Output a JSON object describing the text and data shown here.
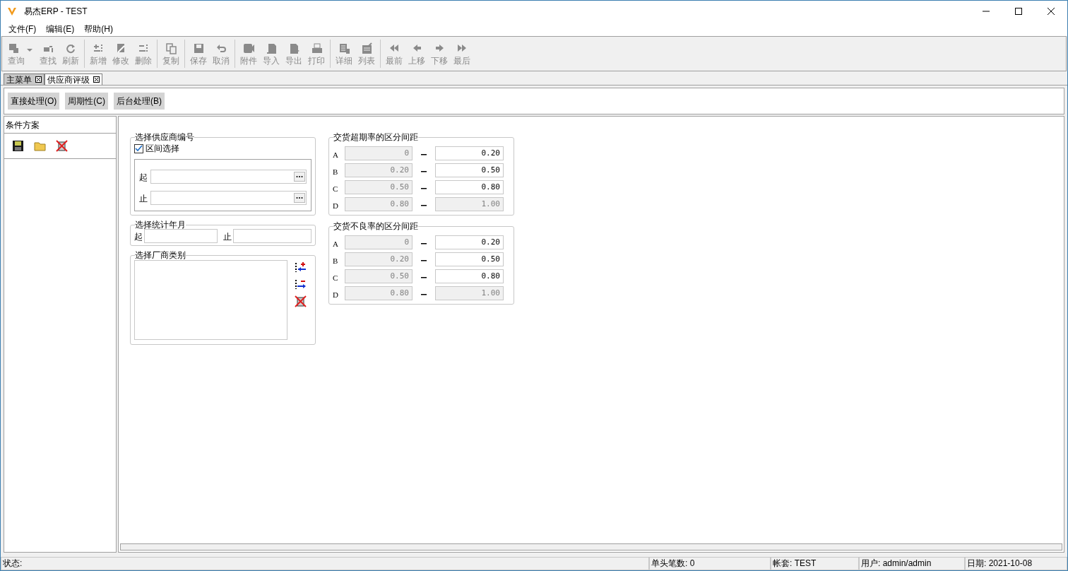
{
  "window": {
    "title": "易杰ERP - TEST"
  },
  "menu": [
    "文件(F)",
    "编辑(E)",
    "帮助(H)"
  ],
  "toolbar": [
    [
      {
        "label": "查询",
        "dropdown": true,
        "disabled": true
      },
      {
        "label": "查找",
        "disabled": true
      },
      {
        "label": "刷新",
        "disabled": true
      }
    ],
    [
      {
        "label": "新增",
        "disabled": true
      },
      {
        "label": "修改",
        "disabled": true
      },
      {
        "label": "删除",
        "disabled": true
      }
    ],
    [
      {
        "label": "复制",
        "disabled": true
      }
    ],
    [
      {
        "label": "保存",
        "disabled": true
      },
      {
        "label": "取消",
        "disabled": true
      }
    ],
    [
      {
        "label": "附件",
        "disabled": true
      },
      {
        "label": "导入",
        "disabled": true
      },
      {
        "label": "导出",
        "disabled": true
      },
      {
        "label": "打印",
        "disabled": true
      }
    ],
    [
      {
        "label": "详细",
        "disabled": true
      },
      {
        "label": "列表",
        "disabled": true
      }
    ],
    [
      {
        "label": "最前",
        "disabled": true
      },
      {
        "label": "上移",
        "disabled": true
      },
      {
        "label": "下移",
        "disabled": true
      },
      {
        "label": "最后",
        "disabled": true
      }
    ]
  ],
  "tabs": [
    {
      "label": "主菜单",
      "selected": false
    },
    {
      "label": "供应商评级",
      "selected": true
    }
  ],
  "actions": [
    "直接处理(O)",
    "周期性(C)",
    "后台处理(B)"
  ],
  "sidebar": {
    "title": "条件方案"
  },
  "supplier": {
    "legend": "选择供应商编号",
    "range_checkbox": {
      "label": "区间选择",
      "checked": true
    },
    "from_label": "起",
    "to_label": "止"
  },
  "period": {
    "legend": "选择统计年月",
    "from_label": "起",
    "to_label": "止"
  },
  "category": {
    "legend": "选择厂商类别"
  },
  "ranges": [
    {
      "legend": "交货超期率的区分间距",
      "rows": [
        {
          "grade": "A",
          "from": "0",
          "to": "0.20",
          "to_disabled": false
        },
        {
          "grade": "B",
          "from": "0.20",
          "to": "0.50",
          "to_disabled": false
        },
        {
          "grade": "C",
          "from": "0.50",
          "to": "0.80",
          "to_disabled": false
        },
        {
          "grade": "D",
          "from": "0.80",
          "to": "1.00",
          "to_disabled": true
        }
      ]
    },
    {
      "legend": "交货不良率的区分间距",
      "rows": [
        {
          "grade": "A",
          "from": "0",
          "to": "0.20",
          "to_disabled": false
        },
        {
          "grade": "B",
          "from": "0.20",
          "to": "0.50",
          "to_disabled": false
        },
        {
          "grade": "C",
          "from": "0.50",
          "to": "0.80",
          "to_disabled": false
        },
        {
          "grade": "D",
          "from": "0.80",
          "to": "1.00",
          "to_disabled": true
        }
      ]
    }
  ],
  "status_bar": [
    "状态:",
    "单头笔数: 0",
    "帐套: TEST",
    "用户: admin/admin",
    "日期: 2021-10-08"
  ]
}
